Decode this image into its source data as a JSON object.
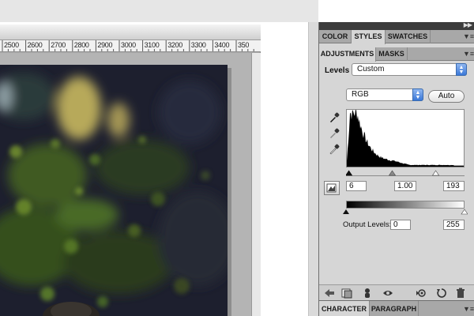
{
  "ruler": {
    "ticks": [
      "2500",
      "2600",
      "2700",
      "2800",
      "2900",
      "3000",
      "3100",
      "3200",
      "3300",
      "3400",
      "350"
    ]
  },
  "panel": {
    "top_tabs": [
      {
        "label": "COLOR",
        "active": false
      },
      {
        "label": "STYLES",
        "active": true
      },
      {
        "label": "SWATCHES",
        "active": false
      }
    ],
    "middle_tabs": [
      {
        "label": "ADJUSTMENTS",
        "active": true
      },
      {
        "label": "MASKS",
        "active": false
      }
    ],
    "bottom_tabs": [
      {
        "label": "CHARACTER",
        "active": true
      },
      {
        "label": "PARAGRAPH",
        "active": false
      }
    ],
    "menu_icon": "panel-menu-icon",
    "collapse_icon": "double-chevron-right-icon"
  },
  "levels": {
    "label": "Levels",
    "preset_value": "Custom",
    "channel_value": "RGB",
    "auto_label": "Auto",
    "input_black": "6",
    "input_gamma": "1.00",
    "input_white": "193",
    "input_black_fraction": 0.024,
    "input_gamma_fraction": 0.39,
    "input_white_fraction": 0.757,
    "output_label": "Output Levels:",
    "output_black": "0",
    "output_white": "255",
    "histogram_color": "#000000"
  },
  "icons": {
    "eyedroppers": [
      "black-point-eyedropper-icon",
      "gray-point-eyedropper-icon",
      "white-point-eyedropper-icon"
    ],
    "bottom_bar": [
      "back-arrow-icon",
      "layer-thumbnail-icon",
      "clip-layer-icon",
      "eye-icon",
      "previous-state-icon",
      "reset-icon",
      "trash-icon"
    ]
  }
}
